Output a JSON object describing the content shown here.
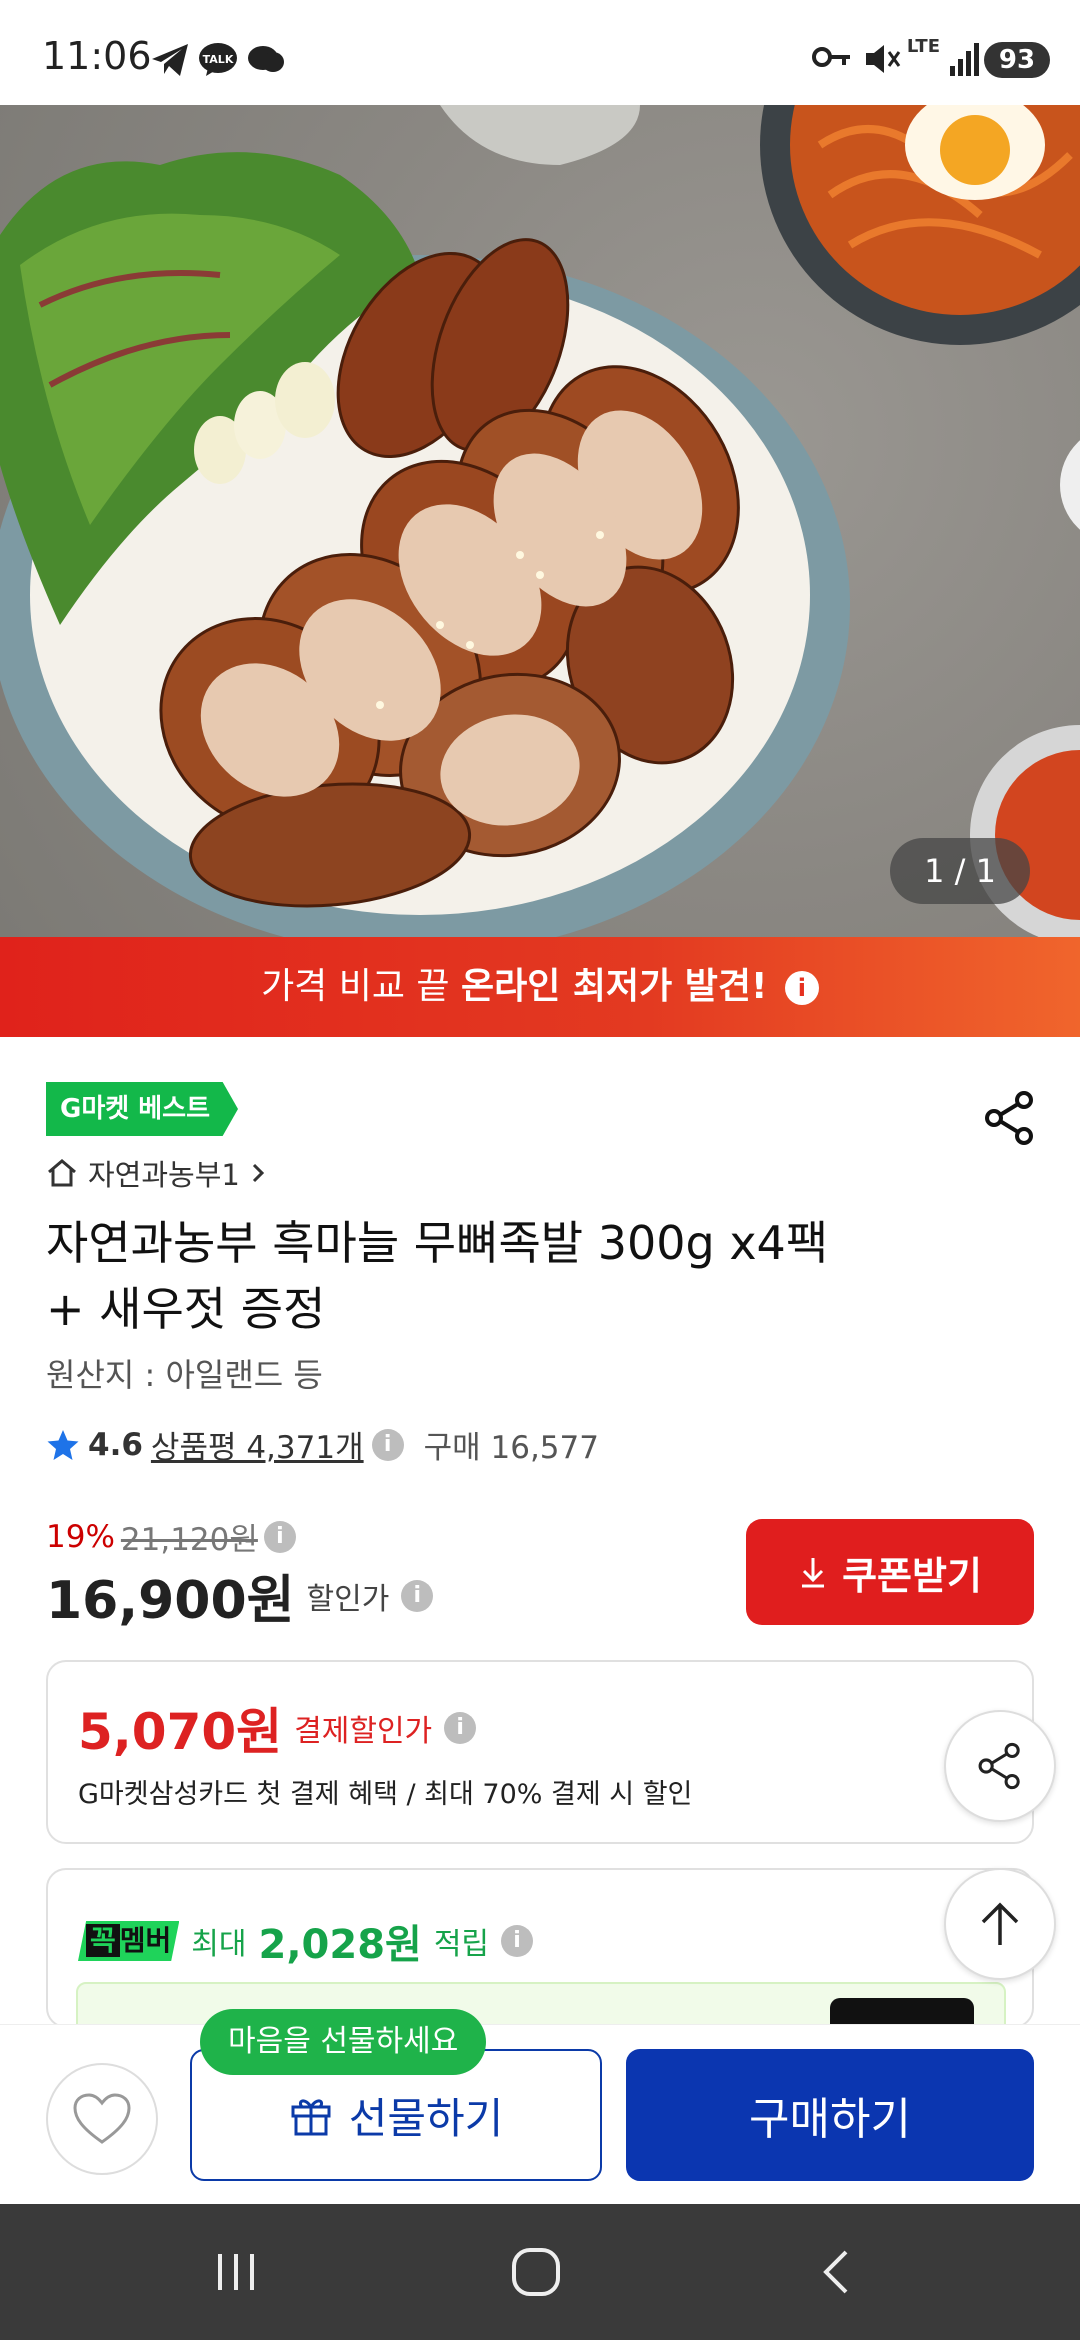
{
  "status_bar": {
    "time": "11:06",
    "network": "LTE",
    "battery": "93"
  },
  "gallery": {
    "counter": "1 / 1"
  },
  "banner": {
    "prefix": "가격 비교 끝",
    "highlight": "온라인 최저가 발견!",
    "info_icon": "i"
  },
  "product": {
    "badge": "G마켓 베스트",
    "store": "자연과농부1",
    "title_line1": "자연과농부 흑마늘 무뼈족발 300g x4팩",
    "title_line2": "+ 새우젓 증정",
    "origin": "원산지 : 아일랜드 등",
    "rating": "4.6",
    "reviews": "상품평 4,371개",
    "sales": "구매 16,577"
  },
  "pricing": {
    "discount_rate": "19%",
    "original_price": "21,120원",
    "price": "16,900원",
    "price_label": "할인가",
    "coupon_button": "쿠폰받기"
  },
  "card_offer": {
    "amount": "5,070원",
    "label": "결제할인가",
    "description": "G마켓삼성카드 첫 결제 혜택 / 최대 70% 결제 시 할인"
  },
  "member_offer": {
    "logo_left": "꼭",
    "logo_right": "멤버",
    "prefix": "최대",
    "amount": "2,028원",
    "suffix": "적립"
  },
  "actions": {
    "gift_tooltip": "마음을 선물하세요",
    "gift_button": "선물하기",
    "buy_button": "구매하기"
  },
  "colors": {
    "accent_red": "#e01e1e",
    "primary_blue": "#0b36b0",
    "member_green": "#1fd35a"
  }
}
